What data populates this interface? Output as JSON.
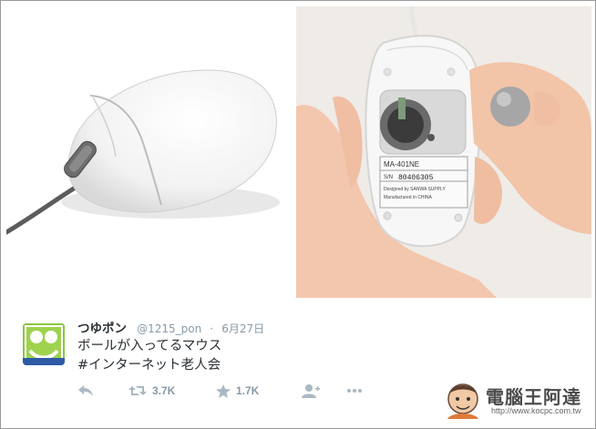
{
  "images": {
    "left": {
      "label": "white mouse photo"
    },
    "right": {
      "label": "mouse underside with ball",
      "sticker_model": "MA-401NE",
      "sticker_sn": "80406305",
      "sticker_line1": "Designed by SANWA SUPPLY",
      "sticker_line2": "Manufactured in CHINA"
    }
  },
  "tweet": {
    "display_name": "つゆポン",
    "handle": "@1215_pon",
    "dot": "·",
    "date": "6月27日",
    "line1": "ボールが入ってるマウス",
    "line2": "#インターネット老人会",
    "retweet_count": "3.7K",
    "favorite_count": "1.7K"
  },
  "watermark": {
    "text": "電腦王阿達",
    "url": "http://www.kocpc.com.tw"
  },
  "colors": {
    "action_gray": "#8899a6",
    "text": "#292f33",
    "avatar_green": "#8cc63f"
  }
}
